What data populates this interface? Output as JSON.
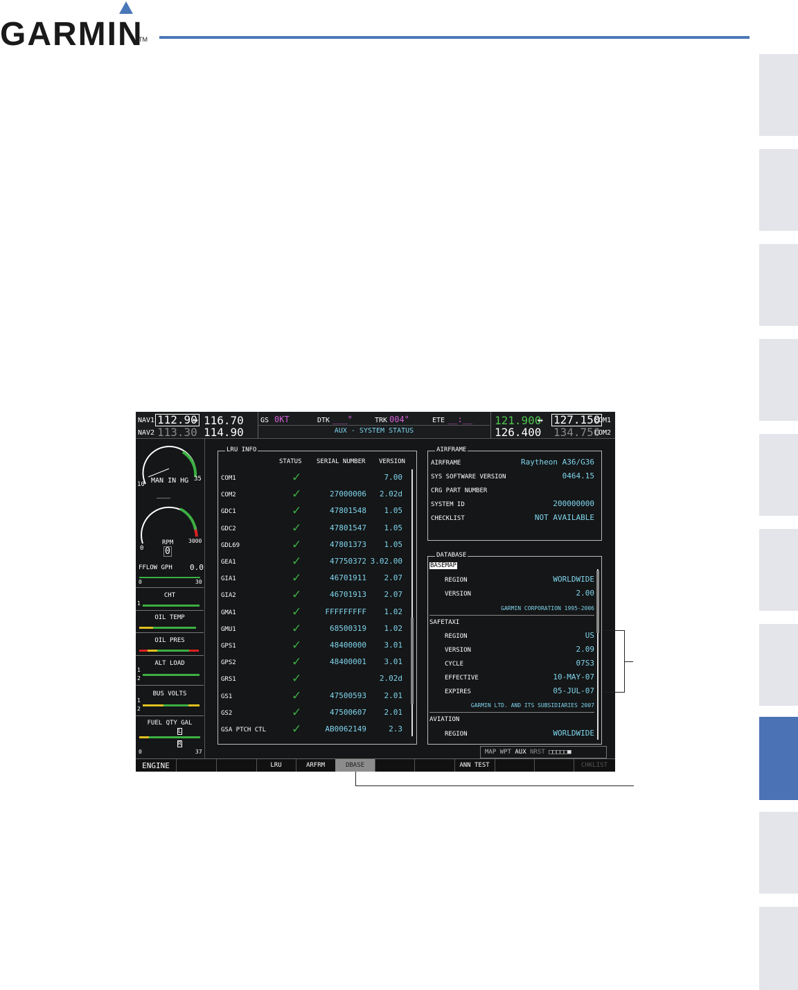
{
  "header": {
    "brand": "GARMIN",
    "tm": "TM"
  },
  "topbar": {
    "nav1_label": "NAV1",
    "nav1_active": "112.90",
    "nav1_standby": "116.70",
    "nav2_label": "NAV2",
    "nav2_active": "113.30",
    "nav2_standby": "114.90",
    "gs_label": "GS",
    "gs_value": "0KT",
    "dtk_label": "DTK",
    "dtk_value": "___°",
    "trk_label": "TRK",
    "trk_value": "004°",
    "ete_label": "ETE",
    "ete_value": "__:__",
    "page_title": "AUX - SYSTEM STATUS",
    "com1_active": "121.900",
    "com1_standby": "127.150",
    "com1_label": "COM1",
    "com2_active": "126.400",
    "com2_standby": "134.750",
    "com2_label": "COM2",
    "swap_glyph": "↔"
  },
  "engine": {
    "man_label": "MAN IN HG",
    "man_min": "10",
    "man_max": "35",
    "man_value": "___",
    "rpm_label": "RPM",
    "rpm_min": "0",
    "rpm_max": "3000",
    "rpm_value": "0",
    "fflow_label": "FFLOW GPH",
    "fflow_value": "0.0",
    "fflow_min": "0",
    "fflow_max": "30",
    "cht_label": "CHT",
    "oil_temp_label": "OIL TEMP",
    "oil_pres_label": "OIL PRES",
    "alt_load_label": "ALT LOAD",
    "bus_volts_label": "BUS VOLTS",
    "fuel_label": "FUEL QTY GAL",
    "fuel_min": "0",
    "fuel_max": "37",
    "marker_1": "1",
    "marker_2": "2",
    "marker_l": "L",
    "marker_r": "R"
  },
  "lru": {
    "title": "LRU INFO",
    "columns": [
      "STATUS",
      "SERIAL NUMBER",
      "VERSION"
    ],
    "check_glyph": "✓",
    "rows": [
      {
        "name": "COM1",
        "serial": "",
        "version": "7.00"
      },
      {
        "name": "COM2",
        "serial": "27000006",
        "version": "2.02d"
      },
      {
        "name": "GDC1",
        "serial": "47801548",
        "version": "1.05"
      },
      {
        "name": "GDC2",
        "serial": "47801547",
        "version": "1.05"
      },
      {
        "name": "GDL69",
        "serial": "47801373",
        "version": "1.05"
      },
      {
        "name": "GEA1",
        "serial": "47750372",
        "version": "3.02.00"
      },
      {
        "name": "GIA1",
        "serial": "46701911",
        "version": "2.07"
      },
      {
        "name": "GIA2",
        "serial": "46701913",
        "version": "2.07"
      },
      {
        "name": "GMA1",
        "serial": "FFFFFFFFF",
        "version": "1.02"
      },
      {
        "name": "GMU1",
        "serial": "68500319",
        "version": "1.02"
      },
      {
        "name": "GPS1",
        "serial": "48400000",
        "version": "3.01"
      },
      {
        "name": "GPS2",
        "serial": "48400001",
        "version": "3.01"
      },
      {
        "name": "GRS1",
        "serial": "",
        "version": "2.02d"
      },
      {
        "name": "GS1",
        "serial": "47500593",
        "version": "2.01"
      },
      {
        "name": "GS2",
        "serial": "47500607",
        "version": "2.01"
      },
      {
        "name": "GSA PTCH CTL",
        "serial": "AB0062149",
        "version": "2.3"
      }
    ]
  },
  "airframe": {
    "title": "AIRFRAME",
    "rows": [
      {
        "label": "AIRFRAME",
        "value": "Raytheon A36/G36"
      },
      {
        "label": "SYS SOFTWARE VERSION",
        "value": "0464.15"
      },
      {
        "label": "CRG PART NUMBER",
        "value": ""
      },
      {
        "label": "SYSTEM ID",
        "value": "200000000"
      },
      {
        "label": "CHECKLIST",
        "value": "NOT AVAILABLE"
      }
    ]
  },
  "database": {
    "title": "DATABASE",
    "basemap": {
      "name": "BASEMAP",
      "region_label": "REGION",
      "region": "WORLDWIDE",
      "version_label": "VERSION",
      "version": "2.00",
      "copyright": "GARMIN CORPORATION 1995-2006"
    },
    "safetaxi": {
      "name": "SAFETAXI",
      "region_label": "REGION",
      "region": "US",
      "version_label": "VERSION",
      "version": "2.09",
      "cycle_label": "CYCLE",
      "cycle": "07S3",
      "effective_label": "EFFECTIVE",
      "effective": "10-MAY-07",
      "expires_label": "EXPIRES",
      "expires": "05-JUL-07",
      "copyright": "GARMIN LTD. AND ITS SUBSIDIARIES 2007"
    },
    "aviation": {
      "name": "AVIATION",
      "region_label": "REGION",
      "region": "WORLDWIDE"
    }
  },
  "page_group": {
    "map": "MAP",
    "wpt": "WPT",
    "aux": "AUX",
    "nrst": "NRST",
    "boxes": "□□□□□■"
  },
  "softkeys": [
    "ENGINE",
    "",
    "",
    "LRU",
    "ARFRM",
    "DBASE",
    "",
    "",
    "ANN TEST",
    "",
    "",
    "CHKLIST"
  ]
}
